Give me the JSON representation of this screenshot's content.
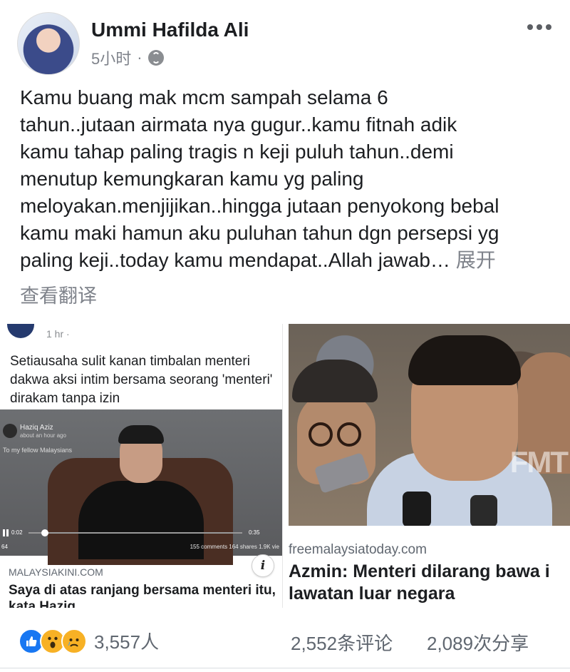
{
  "post": {
    "author": "Ummi Hafilda Ali",
    "time": "5小时",
    "separator": "·",
    "privacy_icon": "globe-icon",
    "text_lines": [
      "Kamu buang mak mcm sampah selama 6",
      "tahun..jutaan airmata nya gugur..kamu fitnah adik",
      "kamu tahap paling tragis n keji puluh tahun..demi",
      "menutup kemungkaran kamu yg paling",
      "meloyakan.menjijikan..hingga jutaan penyokong bebal",
      "kamu maki hamun aku puluhan tahun dgn persepsi yg",
      "paling keji..today kamu mendapat..Allah jawab… "
    ],
    "see_more": "展开",
    "translate": "查看翻译"
  },
  "card_left": {
    "mini_time": "1 hr · ",
    "inner_title": "Setiausaha sulit kanan timbalan menteri dakwa aksi intim bersama seorang 'menteri' dirakam tanpa izin",
    "video": {
      "user_name": "Haziq Aziz",
      "user_sub": "about an hour ago",
      "caption": "To my fellow Malaysians",
      "current_time": "0:02",
      "total_time": "0:35",
      "reactions": "64",
      "stats": "155 comments   164 shares   1.9K vie",
      "progress": 0.06
    },
    "domain": "MALAYSIAKINI.COM",
    "info": "i",
    "title": "Saya di atas ranjang bersama menteri itu, kata Haziq"
  },
  "card_right": {
    "watermark": "FMT",
    "domain": "freemalaysiatoday.com",
    "title_lines": [
      "Azmin: Menteri dilarang bawa i",
      "lawatan luar negara"
    ]
  },
  "footer": {
    "reaction_icons": [
      "like-icon",
      "wow-icon",
      "sad-icon"
    ],
    "reaction_count": "3,557人",
    "comments": "2,552条评论",
    "shares": "2,089次分享"
  },
  "colors": {
    "link_grey": "#7f838b",
    "like_blue": "#1877f2",
    "reaction_yellow": "#f7b125"
  }
}
